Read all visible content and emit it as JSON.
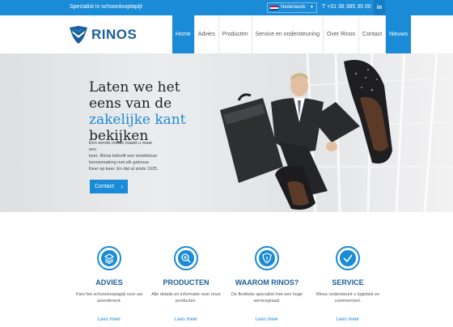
{
  "topbar": {
    "tagline": "Specialist in schoonlooptapijt",
    "language": "Nederlands",
    "phone": "T +31 38 385 35 00",
    "social": "in"
  },
  "brand": {
    "name": "RINOS"
  },
  "nav": {
    "items": [
      "Home",
      "Advies",
      "Producten",
      "Service en ondersteuning",
      "Over Rinos",
      "Contact",
      "Nieuws"
    ]
  },
  "hero": {
    "title_line1": "Laten we het",
    "title_line2": "eens van de",
    "title_highlight": "zakelijke kant",
    "title_line4": "bekijken",
    "text_1": "Een eerste indruk maakt u maar een",
    "text_2": "keer. Rinos belooft een smetteloze",
    "text_3": "kennismaking met elk gebouw.",
    "text_4": "Keer op keer. En dat al sinds 1925.",
    "cta": "Contact"
  },
  "services": [
    {
      "title": "ADVIES",
      "text": "Kies het schoonlooptapijt voor uw assortiment.",
      "more": "Lees meer",
      "icon": "layers-icon"
    },
    {
      "title": "PRODUCTEN",
      "text": "Alle details en informatie over onze producten.",
      "more": "Lees meer",
      "icon": "magnifier-icon"
    },
    {
      "title": "WAAROM RINOS?",
      "text": "De flexibele specialist met een hoge servicegraad.",
      "more": "Lees meer",
      "icon": "shield-icon"
    },
    {
      "title": "SERVICE",
      "text": "Rinos ondersteunt u logistiek en commercieel.",
      "more": "Lees meer",
      "icon": "check-icon"
    }
  ],
  "colors": {
    "accent": "#1a8bd6",
    "brand_dark": "#1b5f99"
  }
}
